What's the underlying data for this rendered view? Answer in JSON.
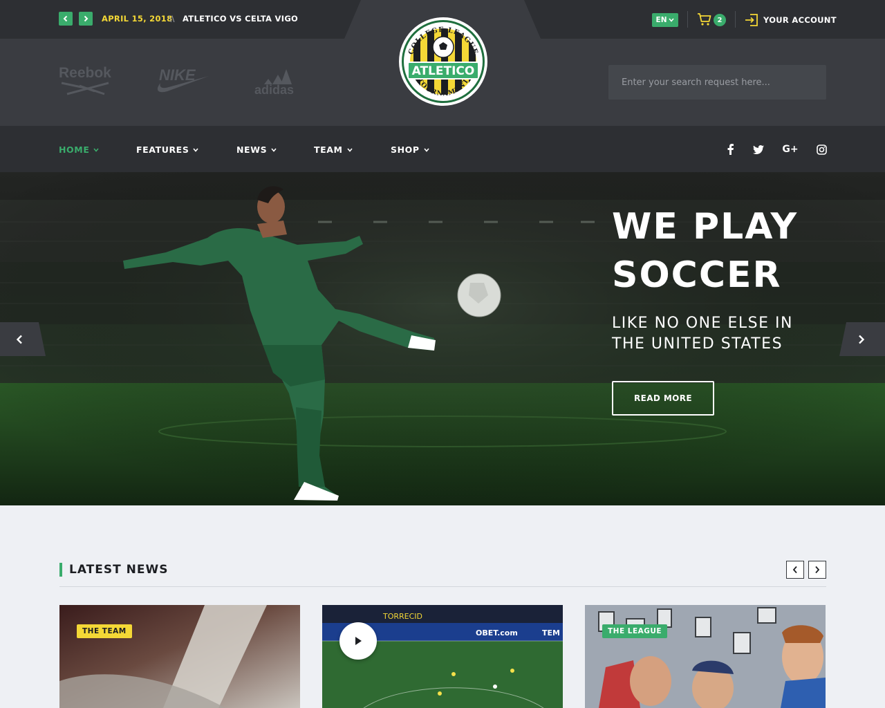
{
  "topbar": {
    "date": "APRIL 15, 2018",
    "separator": "\\\\",
    "match": "ATLETICO VS CELTA VIGO",
    "language": "EN",
    "cart_count": "2",
    "account_label": "YOUR ACCOUNT",
    "icons": [
      "chevron-left-icon",
      "chevron-right-icon",
      "cart-icon",
      "login-icon"
    ]
  },
  "header": {
    "brands": [
      "Reebok",
      "NIKE",
      "adidas"
    ],
    "crest": {
      "arc_top": "COLLEGE LEAGUE",
      "name": "ATLETICO",
      "arc_bottom": "TOURNAMENT"
    },
    "search": {
      "placeholder": "Enter your search request here..."
    }
  },
  "nav": {
    "items": [
      {
        "label": "HOME",
        "active": true
      },
      {
        "label": "FEATURES",
        "active": false
      },
      {
        "label": "NEWS",
        "active": false
      },
      {
        "label": "TEAM",
        "active": false
      },
      {
        "label": "SHOP",
        "active": false
      }
    ],
    "social": [
      "facebook-icon",
      "twitter-icon",
      "google-plus-icon",
      "instagram-icon"
    ],
    "google_plus_text": "G+"
  },
  "hero": {
    "headline_line1": "WE PLAY",
    "headline_line2": "SOCCER",
    "subline": "LIKE NO ONE ELSE IN THE UNITED STATES",
    "button": "READ MORE"
  },
  "news": {
    "title": "LATEST NEWS",
    "cards": [
      {
        "tag": "THE TEAM",
        "tag_color": "#f4d836",
        "tag_text_color": "#1c1e22"
      },
      {
        "tag": "",
        "video": true,
        "banner_texts": [
          "TORRECID",
          "OBET.com",
          "TEM"
        ]
      },
      {
        "tag": "THE LEAGUE",
        "tag_color": "#3aac6c",
        "tag_text_color": "#ffffff"
      }
    ]
  },
  "colors": {
    "accent_green": "#3aac6c",
    "accent_yellow": "#f4d836",
    "dark_bg": "#2d2f33",
    "header_bg": "#3a3c41"
  }
}
